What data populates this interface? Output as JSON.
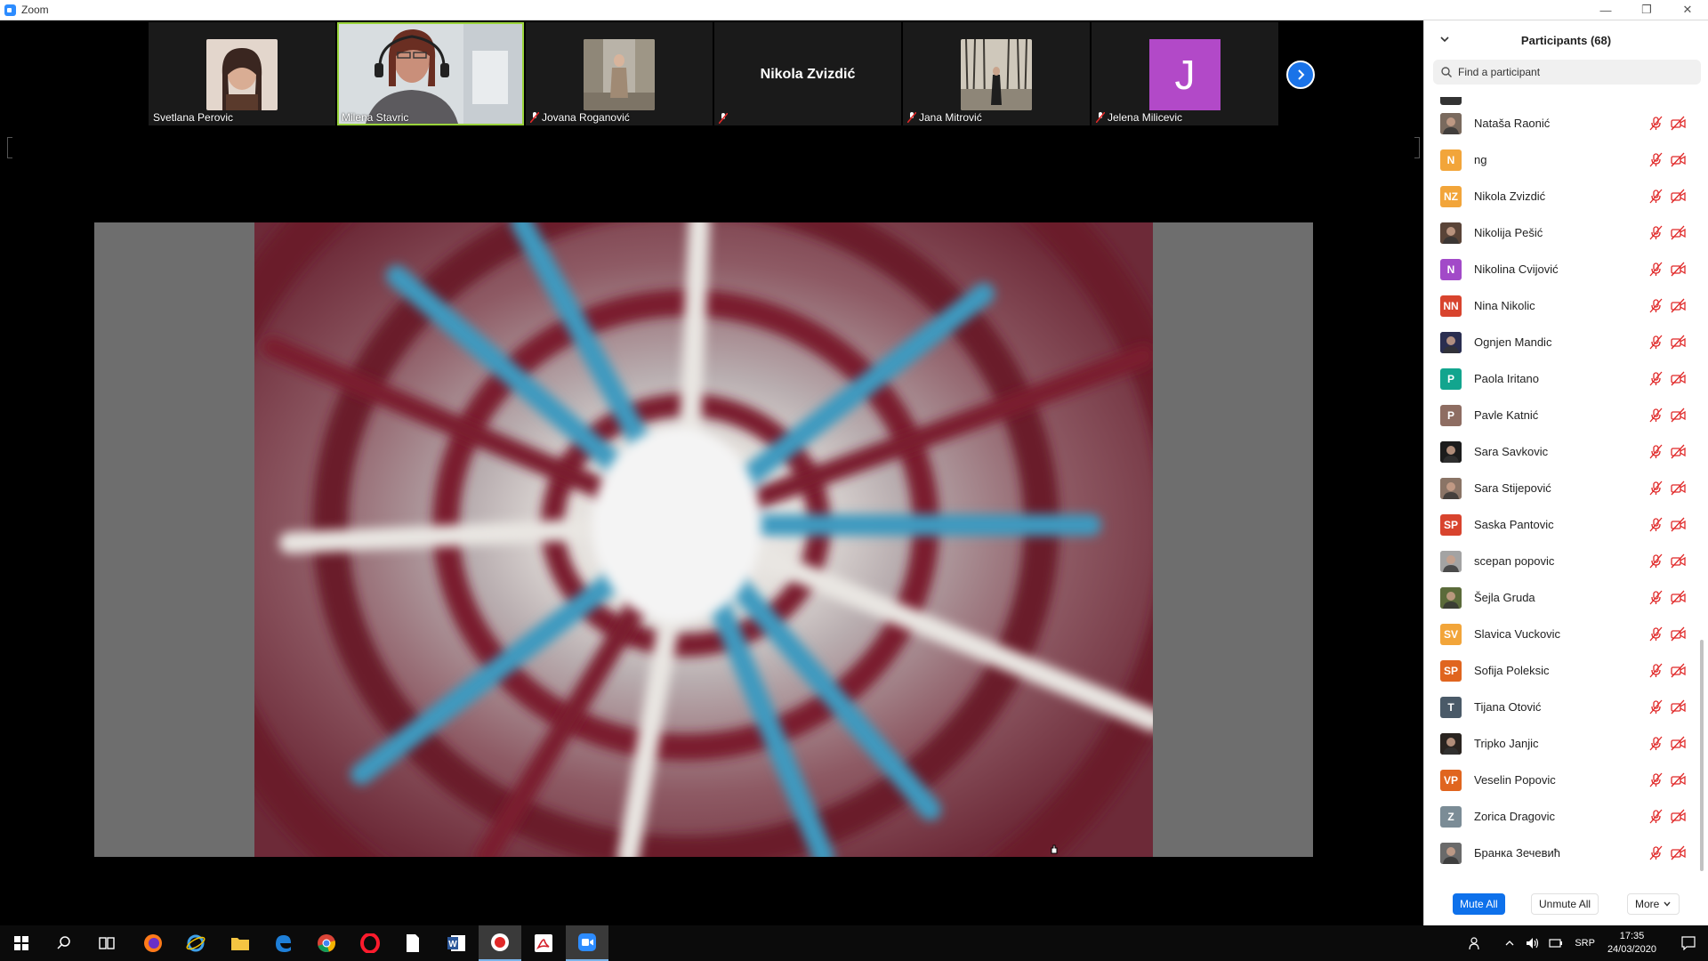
{
  "window": {
    "title": "Zoom"
  },
  "filmstrip": [
    {
      "name": "Svetlana Perovic",
      "muted": false,
      "type": "photo",
      "color": "#6b4f44"
    },
    {
      "name": "Milena Stavric",
      "muted": false,
      "type": "video",
      "active": true
    },
    {
      "name": "Jovana Roganović",
      "muted": true,
      "type": "photo",
      "color": "#8a7a66"
    },
    {
      "name": "",
      "display_name": "Nikola Zvizdić",
      "muted": true,
      "type": "name"
    },
    {
      "name": "Jana Mitrović",
      "muted": true,
      "type": "photo",
      "color": "#6d6a62"
    },
    {
      "name": "Jelena Milicevic",
      "muted": true,
      "type": "initial",
      "initial": "J",
      "color": "#b249c8"
    }
  ],
  "panel": {
    "title": "Participants (68)",
    "search_placeholder": "Find a participant",
    "participants": [
      {
        "name": "Nataša Raonić",
        "avatar": "photo",
        "color": "#7a6a5e"
      },
      {
        "name": "ng",
        "avatar": "initials",
        "initials": "N",
        "color": "#f2a53a"
      },
      {
        "name": "Nikola Zvizdić",
        "avatar": "initials",
        "initials": "NZ",
        "color": "#f2a53a"
      },
      {
        "name": "Nikolija Pešić",
        "avatar": "photo",
        "color": "#5a4438"
      },
      {
        "name": "Nikolina Cvijović",
        "avatar": "initials",
        "initials": "N",
        "color": "#a24ac8"
      },
      {
        "name": "Nina Nikolic",
        "avatar": "initials",
        "initials": "NN",
        "color": "#d8442e"
      },
      {
        "name": "Ognjen Mandic",
        "avatar": "photo",
        "color": "#2a2e50"
      },
      {
        "name": "Paola Iritano",
        "avatar": "initials",
        "initials": "P",
        "color": "#12a58e"
      },
      {
        "name": "Pavle Katnić",
        "avatar": "initials",
        "initials": "P",
        "color": "#8e6d62"
      },
      {
        "name": "Sara Savkovic",
        "avatar": "photo",
        "color": "#1c1c1c"
      },
      {
        "name": "Sara Stijepović",
        "avatar": "photo",
        "color": "#8a7466"
      },
      {
        "name": "Saska Pantovic",
        "avatar": "initials",
        "initials": "SP",
        "color": "#d8442e"
      },
      {
        "name": "scepan popovic",
        "avatar": "photo",
        "color": "#a3a3a3"
      },
      {
        "name": "Šejla Gruda",
        "avatar": "photo",
        "color": "#5b6b3a"
      },
      {
        "name": "Slavica Vuckovic",
        "avatar": "initials",
        "initials": "SV",
        "color": "#f2a53a"
      },
      {
        "name": "Sofija Poleksic",
        "avatar": "initials",
        "initials": "SP",
        "color": "#e0651f"
      },
      {
        "name": "Tijana Otović",
        "avatar": "initials",
        "initials": "T",
        "color": "#4a5a68"
      },
      {
        "name": "Tripko Janjic",
        "avatar": "photo",
        "color": "#2a2420"
      },
      {
        "name": "Veselin Popovic",
        "avatar": "initials",
        "initials": "VP",
        "color": "#e0651f"
      },
      {
        "name": "Zorica Dragovic",
        "avatar": "initials",
        "initials": "Z",
        "color": "#7b8c96"
      },
      {
        "name": "Бранка Зечевић",
        "avatar": "photo",
        "color": "#6a6a6a"
      }
    ],
    "buttons": {
      "mute_all": "Mute All",
      "unmute_all": "Unmute All",
      "more": "More"
    }
  },
  "taskbar": {
    "language": "SRP",
    "time": "17:35",
    "date": "24/03/2020"
  },
  "colors": {
    "accent": "#0e71eb",
    "muted_red": "#e02828",
    "active_speaker": "#9ad43b"
  }
}
